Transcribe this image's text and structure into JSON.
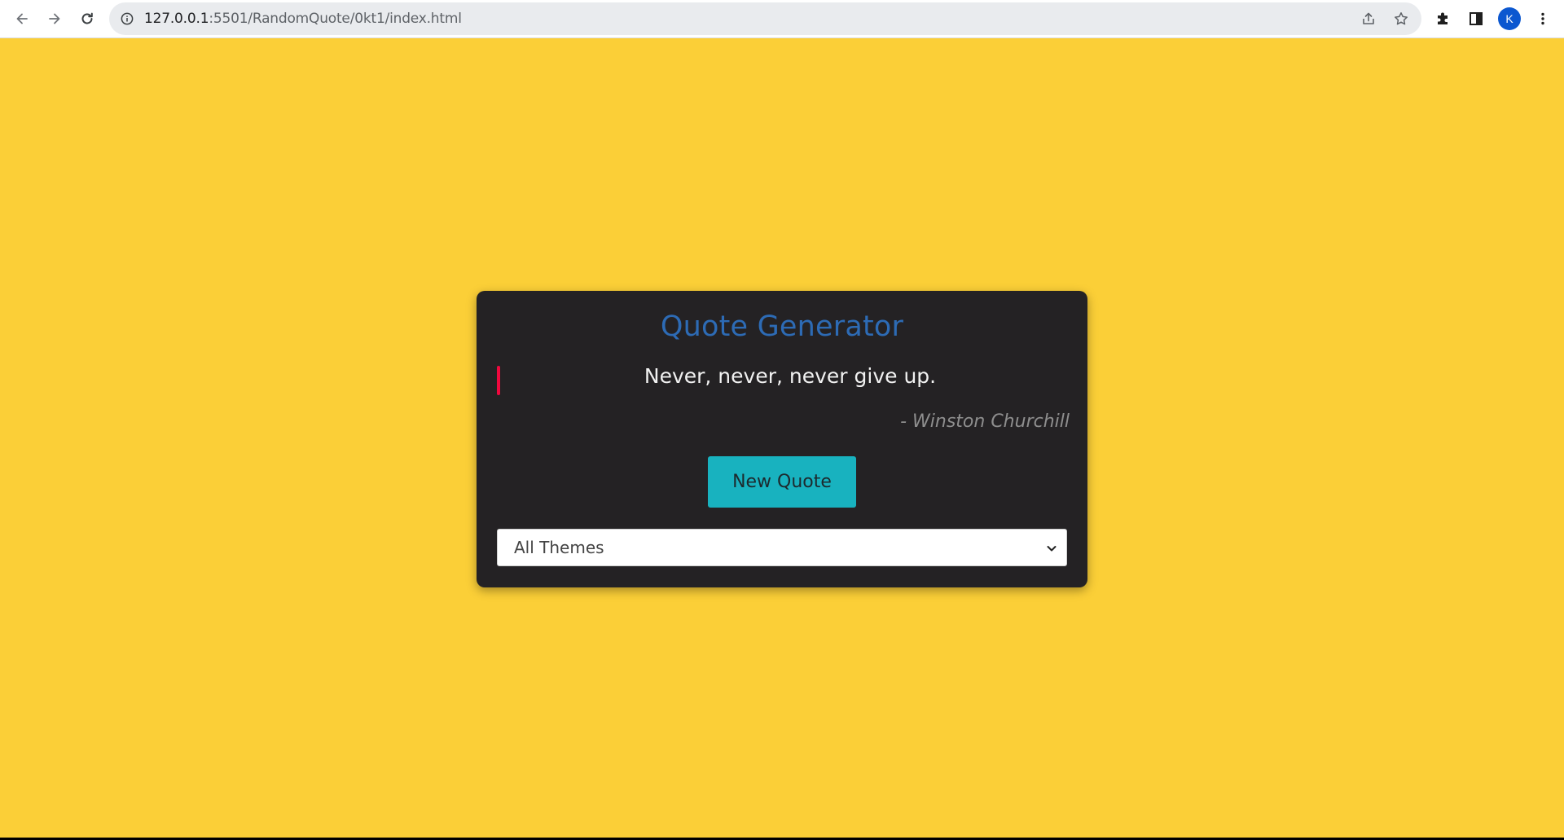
{
  "browser": {
    "url_host": "127.0.0.1",
    "url_path": ":5501/RandomQuote/0kt1/index.html",
    "profile_initial": "K"
  },
  "page": {
    "background_color": "#fbcf37",
    "card_color": "#242224",
    "title": "Quote Generator",
    "title_color": "#2d6bb5",
    "quote": "Never, never, never give up.",
    "author": "- Winston Churchill",
    "accent_bar_color": "#f0083e",
    "new_quote_label": "New Quote",
    "button_color": "#18b2bf",
    "theme_select": {
      "selected": "All Themes"
    }
  }
}
